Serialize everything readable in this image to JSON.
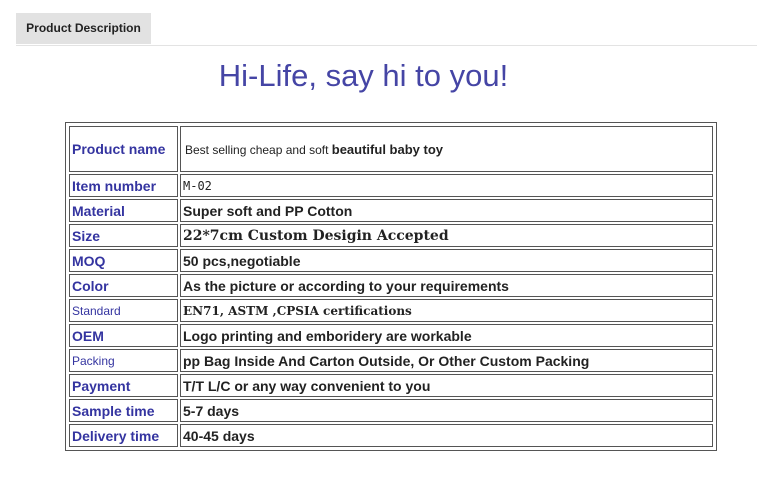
{
  "tab": {
    "label": "Product Description"
  },
  "headline": "Hi-Life, say hi to you!",
  "rows": [
    {
      "key": "Product name",
      "value_plain": "Best selling cheap and soft ",
      "value_bold": "beautiful baby toy"
    },
    {
      "key": "Item number",
      "value": "M-02"
    },
    {
      "key": "Material",
      "value": "Super soft and PP Cotton"
    },
    {
      "key": "Size",
      "value": "22*7cm Custom Desigin Accepted"
    },
    {
      "key": "MOQ",
      "value": "50 pcs,negotiable"
    },
    {
      "key": "Color",
      "value": "As the picture or according to your requirements"
    },
    {
      "key": "Standard",
      "value": "EN71, ASTM ,CPSIA certifications"
    },
    {
      "key": "OEM",
      "value": "Logo printing and emboridery are workable"
    },
    {
      "key": "Packing",
      "value": "pp Bag Inside And Carton Outside, Or Other Custom Packing"
    },
    {
      "key": "Payment",
      "value": "T/T L/C or any way convenient to you"
    },
    {
      "key": "Sample time",
      "value": "5-7 days"
    },
    {
      "key": "Delivery time",
      "value": "40-45 days"
    }
  ]
}
